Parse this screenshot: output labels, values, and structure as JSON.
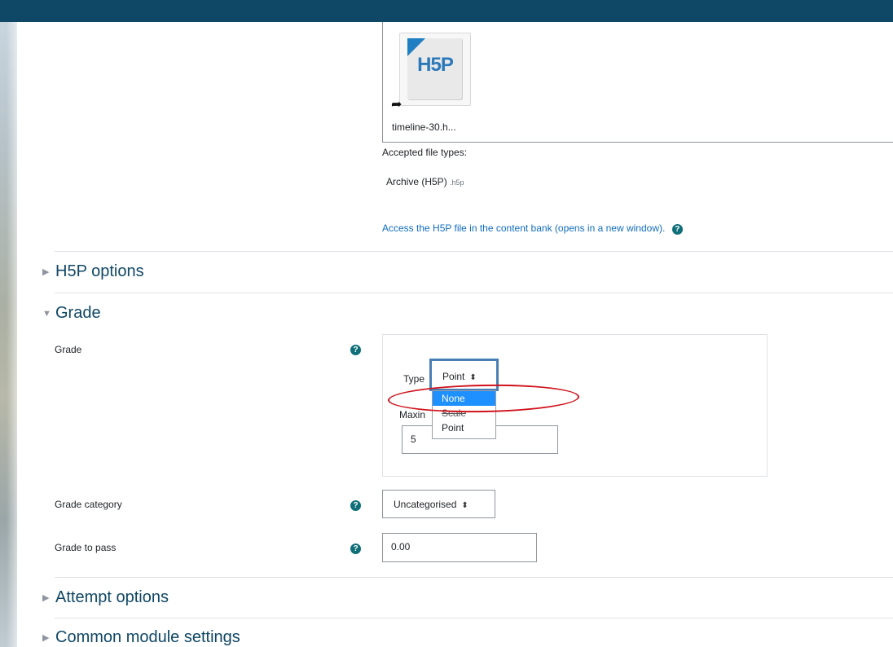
{
  "file": {
    "name": "timeline-30.h...",
    "accepted_label": "Accepted file types:",
    "accepted_type": "Archive (H5P)",
    "accepted_ext": ".h5p",
    "content_bank_link": "Access the H5P file in the content bank (opens in a new window).",
    "h5p_logo_text": "H5P"
  },
  "sections": {
    "h5p_options": "H5P options",
    "grade": "Grade",
    "attempt_options": "Attempt options",
    "common_module": "Common module settings"
  },
  "grade": {
    "grade_label": "Grade",
    "type_label": "Type",
    "type_value": "Point",
    "max_label": "Maxin",
    "max_value": "5",
    "dropdown_options": [
      "None",
      "Scale",
      "Point"
    ],
    "grade_category_label": "Grade category",
    "grade_category_value": "Uncategorised",
    "grade_to_pass_label": "Grade to pass",
    "grade_to_pass_value": "0.00"
  },
  "icons": {
    "help": "?",
    "caret": "⬍"
  },
  "colors": {
    "topbar": "#0f4766",
    "link": "#0f6cbf",
    "highlight": "#1e90ff",
    "annotation": "#d0121b"
  }
}
